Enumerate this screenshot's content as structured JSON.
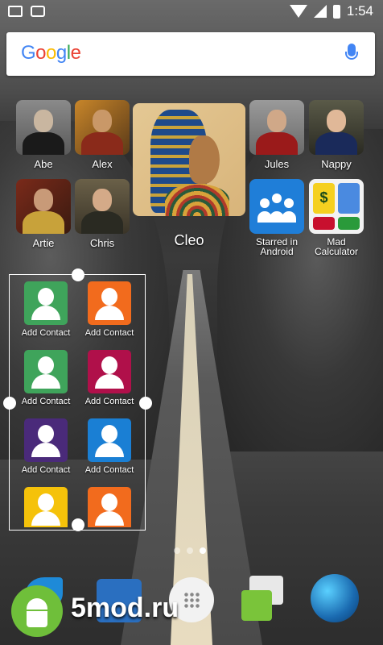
{
  "status_bar": {
    "time": "1:54",
    "left_icons": [
      "gmail-icon",
      "briefcase-icon"
    ],
    "right_icons": [
      "wifi-icon",
      "signal-icon",
      "battery-icon"
    ]
  },
  "search": {
    "logo": "Google",
    "logo_colors": [
      "#4285f4",
      "#ea4335",
      "#fbbc05",
      "#4285f4",
      "#34a853",
      "#ea4335"
    ],
    "mic_icon": "mic-icon"
  },
  "apps": {
    "abe": "Abe",
    "alex": "Alex",
    "cleo": "Cleo",
    "jules": "Jules",
    "nappy": "Nappy",
    "artie": "Artie",
    "chris": "Chris",
    "starred": "Starred in Android",
    "calculator": "Mad Calculator"
  },
  "widget": {
    "contacts": [
      {
        "label": "Add Contact",
        "color": "#3fa45b"
      },
      {
        "label": "Add Contact",
        "color": "#f26b1d"
      },
      {
        "label": "Add Contact",
        "color": "#3fa45b"
      },
      {
        "label": "Add Contact",
        "color": "#b0104a"
      },
      {
        "label": "Add Contact",
        "color": "#4a2a7a"
      },
      {
        "label": "Add Contact",
        "color": "#1a7fd4"
      },
      {
        "label": "",
        "color": "#f5c20a"
      },
      {
        "label": "",
        "color": "#f26b1d"
      }
    ]
  },
  "page_indicator": {
    "pages": 3,
    "active": 2
  },
  "dock": {
    "watermark": "5mod.ru",
    "items": [
      "android-icon",
      "contacts-icon",
      "app-drawer-icon",
      "messaging-icon",
      "browser-globe-icon"
    ]
  }
}
